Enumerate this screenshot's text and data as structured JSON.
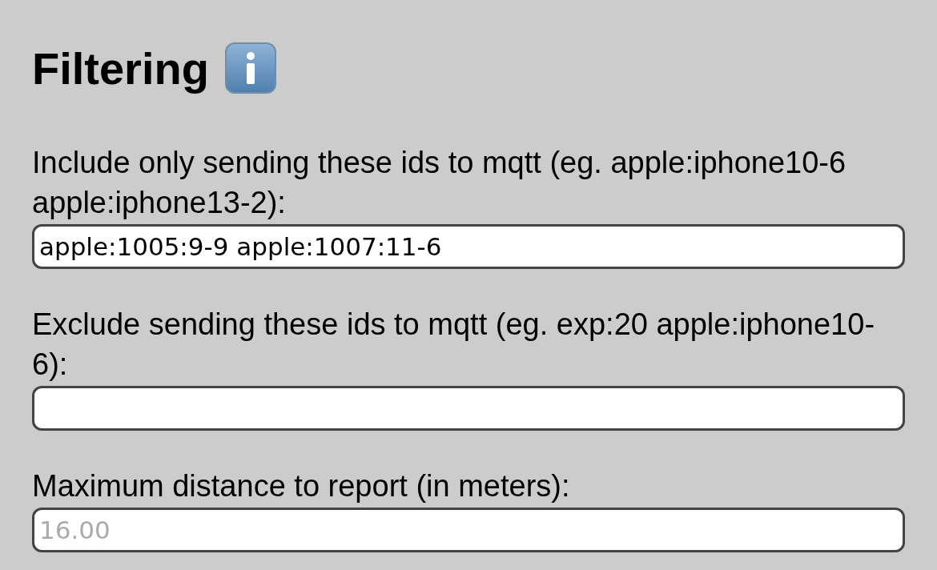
{
  "heading": {
    "title": "Filtering"
  },
  "fields": [
    {
      "label": "Include only sending these ids to mqtt (eg. apple:iphone10-6 apple:iphone13-2):",
      "value": "apple:1005:9-9 apple:1007:11-6"
    },
    {
      "label": "Exclude sending these ids to mqtt (eg. exp:20 apple:iphone10-6):"
    },
    {
      "label": "Maximum distance to report (in meters):",
      "placeholder": "16.00"
    }
  ]
}
